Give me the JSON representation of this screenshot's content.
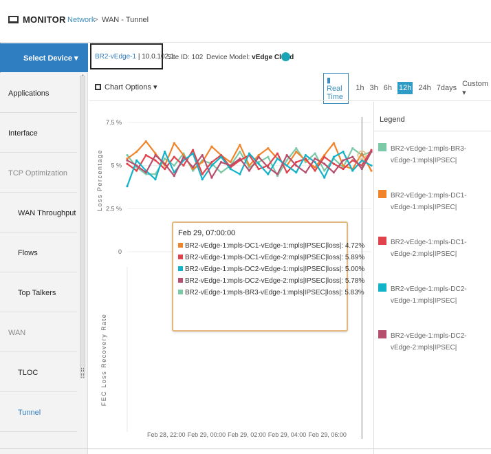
{
  "header": {
    "title": "MONITOR",
    "breadcrumb_link": "Network",
    "breadcrumb_sep": ">",
    "breadcrumb_current": "WAN - Tunnel"
  },
  "device": {
    "select_label": "Select Device",
    "name": "BR2-vEdge-1",
    "ip": "| 10.0.102.1",
    "site_id": "Site ID: 102",
    "model_label": "Device Model:",
    "model_value": "vEdge Cloud",
    "status_color": "#1aa5b6"
  },
  "sidebar": {
    "items": [
      {
        "label": "Applications",
        "kind": "l1"
      },
      {
        "label": "Interface",
        "kind": "l1"
      },
      {
        "label": "TCP Optimization",
        "kind": "section"
      },
      {
        "label": "WAN Throughput",
        "kind": "l2"
      },
      {
        "label": "Flows",
        "kind": "l2"
      },
      {
        "label": "Top Talkers",
        "kind": "l2"
      },
      {
        "label": "WAN",
        "kind": "section"
      },
      {
        "label": "TLOC",
        "kind": "l2"
      },
      {
        "label": "Tunnel",
        "kind": "l2",
        "active": true
      }
    ]
  },
  "toolbar": {
    "chart_options": "Chart Options",
    "realtime": "Real Time",
    "ranges": [
      "1h",
      "3h",
      "6h",
      "12h",
      "24h",
      "7days",
      "Custom"
    ],
    "active_range": "12h"
  },
  "legend": {
    "title": "Legend",
    "items": [
      {
        "label": "BR2-vEdge-1:mpls-BR3-vEdge-1:mpls|IPSEC|",
        "color": "#7cc9a8"
      },
      {
        "label": "BR2-vEdge-1:mpls-DC1-vEdge-1:mpls|IPSEC|",
        "color": "#f0842b"
      },
      {
        "label": "BR2-vEdge-1:mpls-DC1-vEdge-2:mpls|IPSEC|",
        "color": "#e0434b"
      },
      {
        "label": "BR2-vEdge-1:mpls-DC2-vEdge-1:mpls|IPSEC|",
        "color": "#12b3c9"
      },
      {
        "label": "BR2-vEdge-1:mpls-DC2-vEdge-2:mpls|IPSEC|",
        "color": "#b64f6e"
      }
    ]
  },
  "chart_data": {
    "type": "line",
    "ylabel_top": "Loss Percentage",
    "ylabel_bottom": "FEC Loss Recovery Rate",
    "y_ticks": [
      "7.5 %",
      "5 %",
      "2.5 %",
      "0"
    ],
    "ylim": [
      0,
      7.5
    ],
    "x_ticks": [
      "Feb 28, 22:00",
      "Feb 29, 00:00",
      "Feb 29, 02:00",
      "Feb 29, 04:00",
      "Feb 29, 06:00"
    ],
    "series": [
      {
        "name": "BR2-vEdge-1:mpls-BR3-vEdge-1:mpls|IPSEC|",
        "color": "#7cc9a8",
        "values": [
          5.6,
          4.9,
          4.5,
          4.5,
          5.4,
          5.0,
          5.7,
          4.7,
          5.3,
          5.1,
          4.6,
          5.0,
          5.8,
          4.9,
          5.2,
          5.5,
          4.4,
          5.3,
          6.0,
          5.2,
          5.7,
          4.7,
          5.4,
          4.9,
          6.0,
          5.6,
          5.8
        ]
      },
      {
        "name": "BR2-vEdge-1:mpls-DC1-vEdge-1:mpls|IPSEC|",
        "color": "#f0842b",
        "values": [
          5.4,
          5.8,
          6.4,
          5.7,
          5.0,
          6.3,
          5.6,
          4.8,
          5.2,
          6.1,
          5.6,
          5.2,
          6.2,
          5.0,
          5.6,
          6.0,
          5.4,
          5.0,
          5.8,
          5.3,
          4.9,
          5.6,
          6.3,
          5.0,
          4.8,
          5.7,
          4.7
        ]
      },
      {
        "name": "BR2-vEdge-1:mpls-DC1-vEdge-2:mpls|IPSEC|",
        "color": "#e0434b",
        "values": [
          5.1,
          4.7,
          5.6,
          5.3,
          4.8,
          5.5,
          5.0,
          5.9,
          4.5,
          5.2,
          5.6,
          4.9,
          5.3,
          5.6,
          4.8,
          5.0,
          5.7,
          4.6,
          5.2,
          5.4,
          4.7,
          5.5,
          5.1,
          4.8,
          5.3,
          5.0,
          5.9
        ]
      },
      {
        "name": "BR2-vEdge-1:mpls-DC2-vEdge-1:mpls|IPSEC|",
        "color": "#12b3c9",
        "values": [
          3.8,
          5.3,
          4.7,
          4.2,
          5.8,
          4.6,
          5.3,
          5.7,
          4.2,
          5.0,
          5.5,
          4.8,
          4.5,
          5.7,
          5.1,
          4.5,
          5.4,
          5.0,
          4.6,
          5.6,
          5.2,
          4.3,
          5.5,
          5.8,
          4.7,
          5.3,
          5.0
        ]
      },
      {
        "name": "BR2-vEdge-1:mpls-DC2-vEdge-2:mpls|IPSEC|",
        "color": "#b64f6e",
        "values": [
          5.3,
          5.0,
          4.6,
          5.6,
          5.1,
          4.4,
          5.5,
          4.9,
          5.6,
          4.3,
          5.2,
          5.0,
          5.4,
          4.7,
          5.5,
          4.9,
          4.5,
          5.6,
          5.0,
          4.6,
          5.4,
          5.1,
          4.6,
          5.3,
          5.5,
          4.8,
          5.8
        ]
      }
    ]
  },
  "tooltip": {
    "date": "Feb 29, 07:00:00",
    "rows": [
      {
        "text": "BR2-vEdge-1:mpls-DC1-vEdge-1:mpls|IPSEC|loss|: 4.72%",
        "color": "#f0842b"
      },
      {
        "text": "BR2-vEdge-1:mpls-DC1-vEdge-2:mpls|IPSEC|loss|: 5.89%",
        "color": "#e0434b"
      },
      {
        "text": "BR2-vEdge-1:mpls-DC2-vEdge-1:mpls|IPSEC|loss|: 5.00%",
        "color": "#12b3c9"
      },
      {
        "text": "BR2-vEdge-1:mpls-DC2-vEdge-2:mpls|IPSEC|loss|: 5.78%",
        "color": "#b64f6e"
      },
      {
        "text": "BR2-vEdge-1:mpls-BR3-vEdge-1:mpls|IPSEC|loss|: 5.83%",
        "color": "#7cc9a8"
      }
    ]
  }
}
